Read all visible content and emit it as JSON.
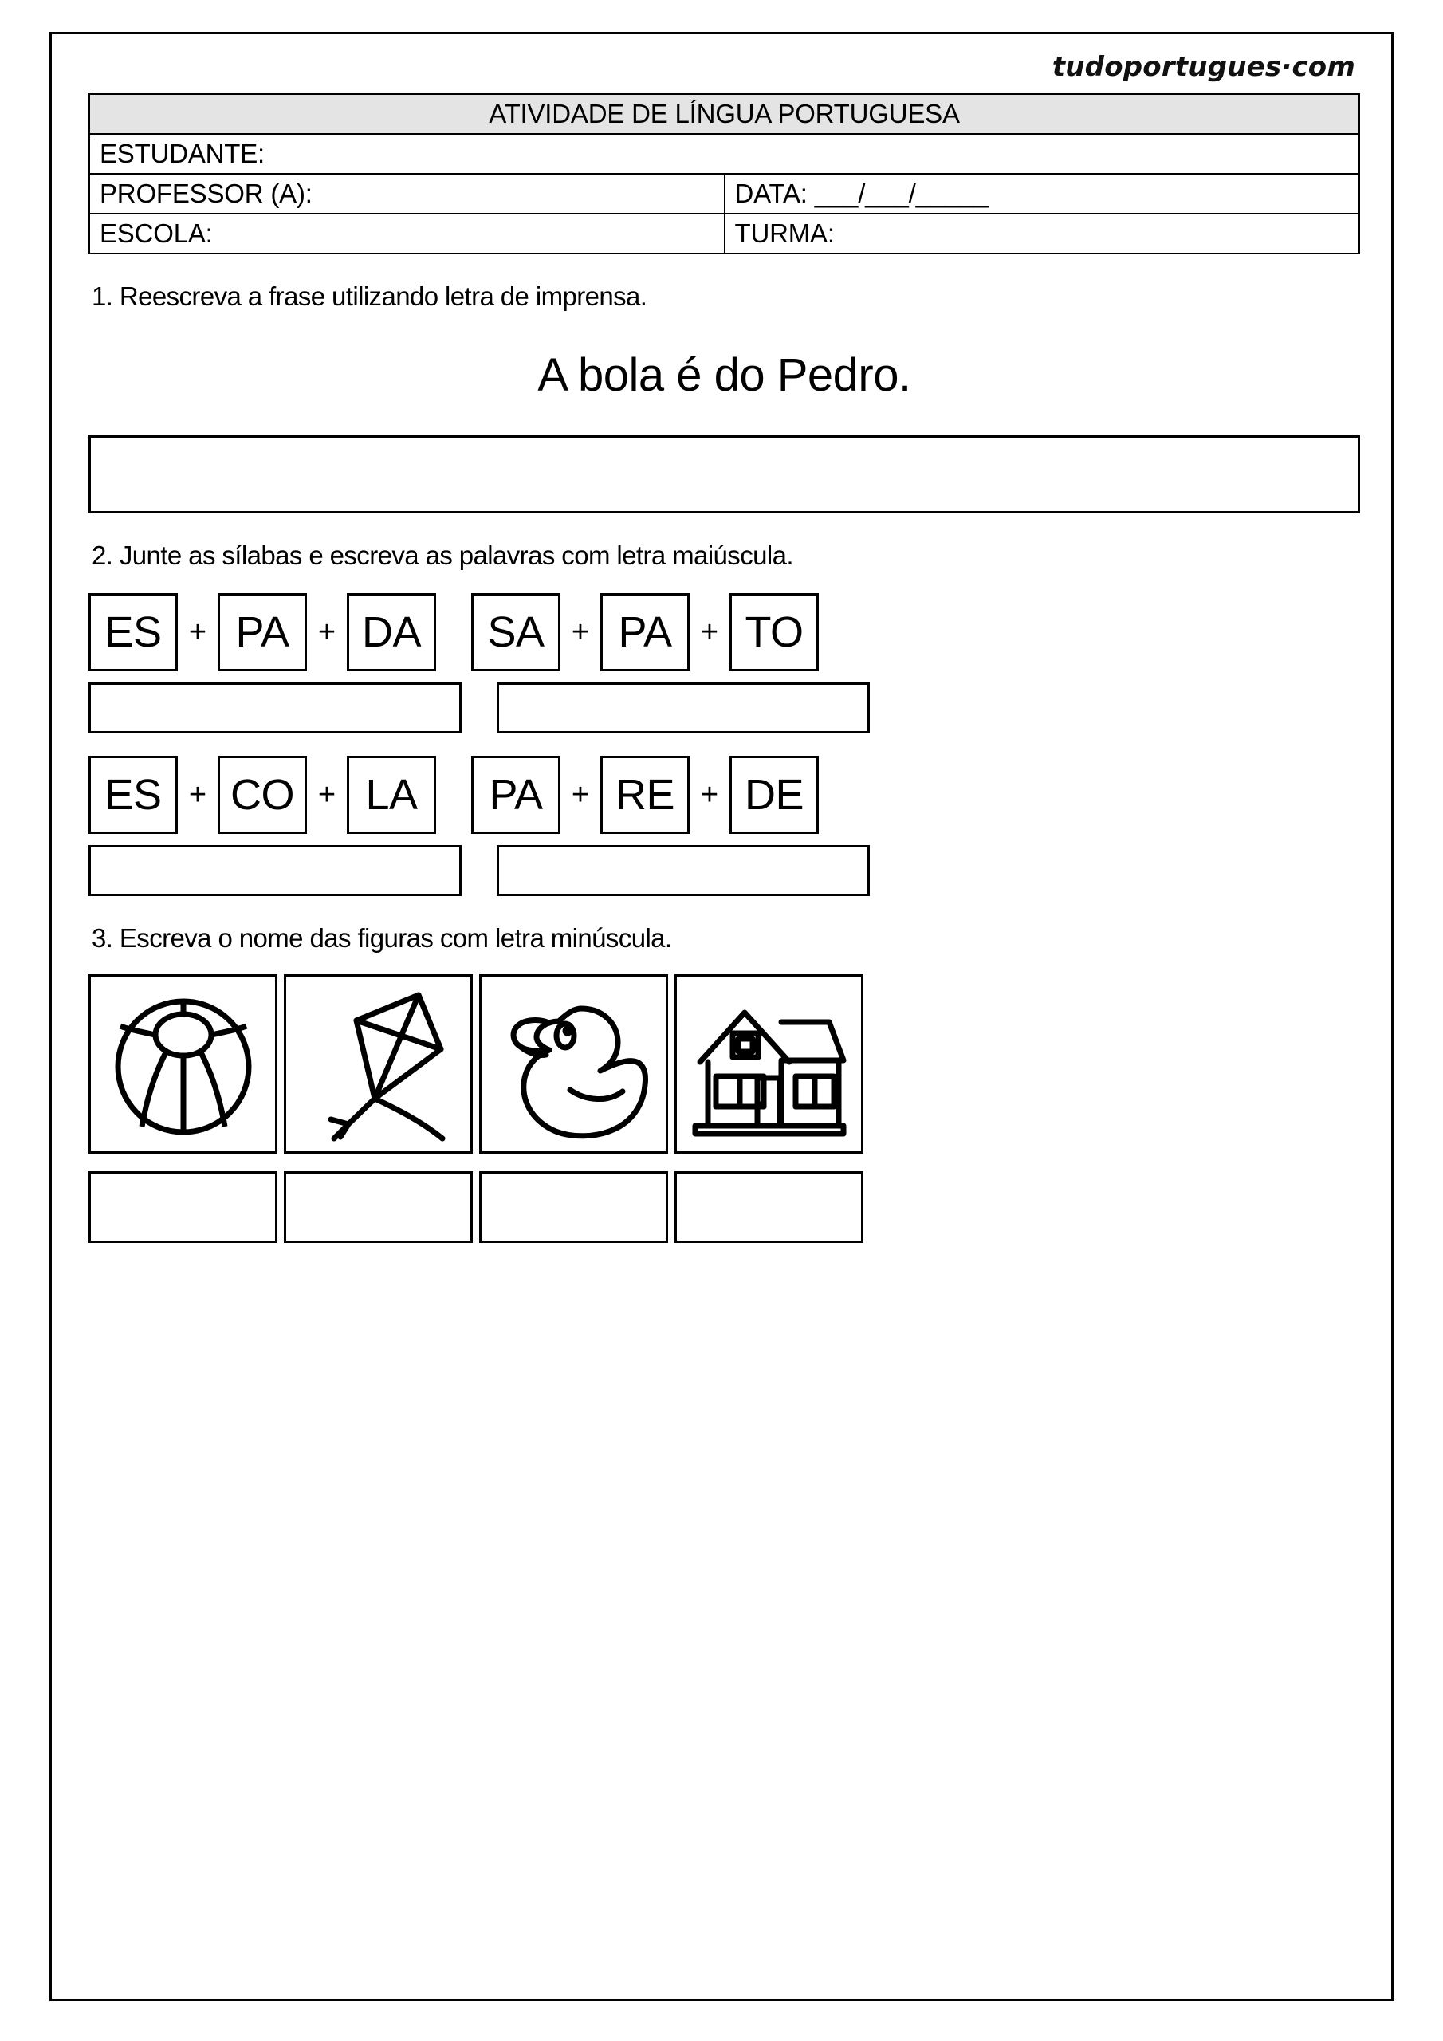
{
  "watermark": "tudoportugues·com",
  "header": {
    "title": "ATIVIDADE DE LÍNGUA PORTUGUESA",
    "fields": {
      "student_label": "ESTUDANTE:",
      "teacher_label": "PROFESSOR (A):",
      "school_label": "ESCOLA:",
      "date_label": "DATA:  ___/___/_____",
      "class_label": "TURMA:"
    }
  },
  "questions": {
    "q1": {
      "prompt": "1. Reescreva a frase utilizando letra de imprensa.",
      "sentence": "A bola é do Pedro.",
      "answer_value": ""
    },
    "q2": {
      "prompt": "2. Junte as sílabas e escreva as palavras com letra maiúscula.",
      "rows": [
        {
          "groups": [
            {
              "syllables": [
                "ES",
                "PA",
                "DA"
              ],
              "operator": "+",
              "answer_value": ""
            },
            {
              "syllables": [
                "SA",
                "PA",
                "TO"
              ],
              "operator": "+",
              "answer_value": ""
            }
          ]
        },
        {
          "groups": [
            {
              "syllables": [
                "ES",
                "CO",
                "LA"
              ],
              "operator": "+",
              "answer_value": ""
            },
            {
              "syllables": [
                "PA",
                "RE",
                "DE"
              ],
              "operator": "+",
              "answer_value": ""
            }
          ]
        }
      ]
    },
    "q3": {
      "prompt": "3. Escreva o nome das figuras com letra minúscula.",
      "figures": [
        {
          "icon": "beach-ball-icon",
          "answer_value": ""
        },
        {
          "icon": "kite-icon",
          "answer_value": ""
        },
        {
          "icon": "rubber-duck-icon",
          "answer_value": ""
        },
        {
          "icon": "house-icon",
          "answer_value": ""
        }
      ]
    }
  },
  "colors": {
    "ink": "#000000",
    "paper": "#ffffff",
    "header_fill": "#e4e4e4"
  }
}
